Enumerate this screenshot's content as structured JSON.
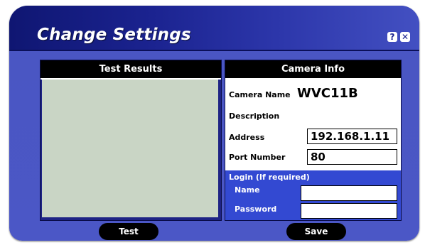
{
  "window": {
    "title": "Change Settings",
    "help_icon": "?",
    "close_icon": "✕"
  },
  "test_results": {
    "header": "Test Results"
  },
  "camera_info": {
    "header": "Camera Info",
    "camera_name_label": "Camera Name",
    "camera_name_value": "WVC11B",
    "description_label": "Description",
    "address_label": "Address",
    "address_value": "192.168.1.11",
    "port_label": "Port Number",
    "port_value": "80"
  },
  "login": {
    "title": "Login (If required)",
    "name_label": "Name",
    "name_value": "",
    "password_label": "Password",
    "password_value": ""
  },
  "buttons": {
    "test_label": "Test",
    "save_label": "Save"
  },
  "colors": {
    "title_bar": "#1b2390",
    "window_body": "#4a56c2",
    "results_area": "#c9d5c5",
    "login_section": "#3349d2"
  }
}
